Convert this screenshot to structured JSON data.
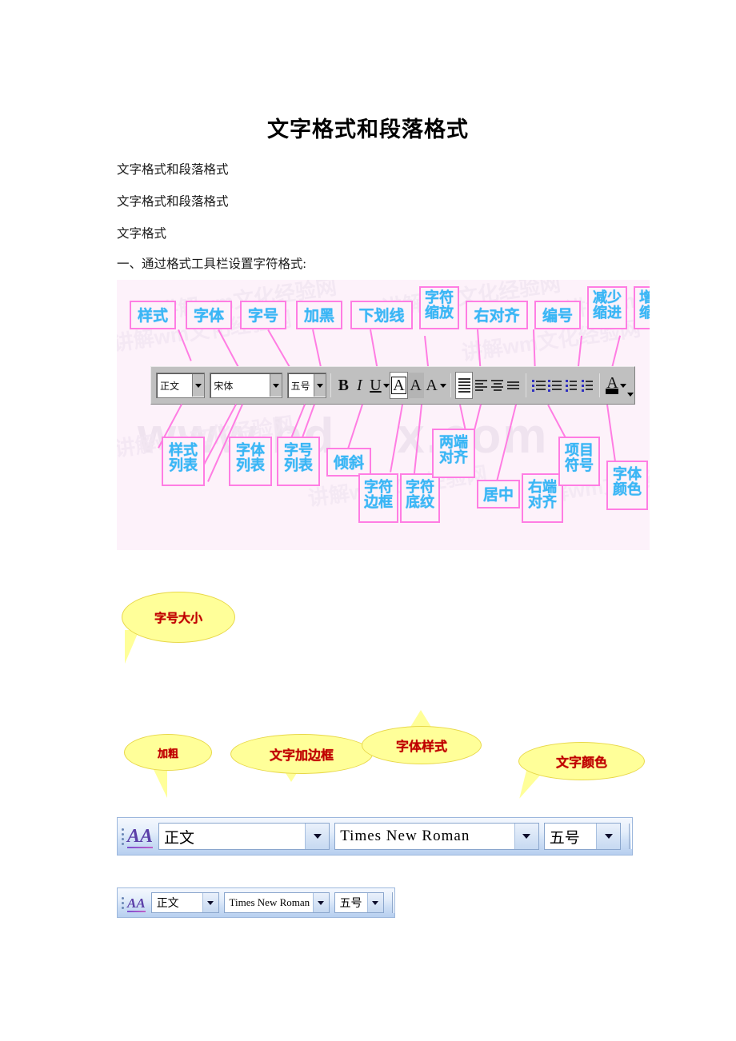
{
  "document": {
    "title": "文字格式和段落格式",
    "paragraphs": [
      "文字格式和段落格式",
      "文字格式和段落格式",
      "文字格式",
      "一、通过格式工具栏设置字符格式:"
    ]
  },
  "diagram": {
    "watermark_main": "www.bd",
    "watermark_main_tail": "x.com",
    "watermark_dot": ".",
    "watermark_small": "讲解wm文化经验网",
    "top_labels": [
      {
        "text": "样式"
      },
      {
        "text": "字体"
      },
      {
        "text": "字号"
      },
      {
        "text": "加黑"
      },
      {
        "text": "下划线"
      },
      {
        "line1": "字符",
        "line2": "缩放"
      },
      {
        "text": "右对齐"
      },
      {
        "text": "编号"
      },
      {
        "line1": "减少",
        "line2": "缩进"
      },
      {
        "line1": "增加",
        "line2": "缩进"
      }
    ],
    "bottom_labels": [
      {
        "line1": "样式",
        "line2": "列表"
      },
      {
        "line1": "字体",
        "line2": "列表"
      },
      {
        "line1": "字号",
        "line2": "列表"
      },
      {
        "text": "倾斜"
      },
      {
        "line1": "字符",
        "line2": "边框"
      },
      {
        "line1": "字符",
        "line2": "底纹"
      },
      {
        "line1": "两端",
        "line2": "对齐"
      },
      {
        "text": "居中"
      },
      {
        "line1": "右端",
        "line2": "对齐"
      },
      {
        "line1": "项目",
        "line2": "符号"
      },
      {
        "line1": "字体",
        "line2": "颜色"
      }
    ],
    "toolbar97": {
      "style_value": "正文",
      "font_value": "宋体",
      "size_value": "五号",
      "bold_label": "B",
      "italic_label": "I",
      "underline_label": "U",
      "border_label": "A",
      "shading_label": "A",
      "scale_label": "A",
      "color_label": "A"
    }
  },
  "bubbles": [
    {
      "text": "字号大小"
    },
    {
      "text": "加粗"
    },
    {
      "text": "文字加边框"
    },
    {
      "text": "字体样式"
    },
    {
      "text": "文字颜色"
    }
  ],
  "word_toolbar_large": {
    "style_value": "正文",
    "font_value": "Times New Roman",
    "size_value": "五号",
    "styles_icon_label": "AA"
  },
  "word_toolbar_small": {
    "style_value": "正文",
    "font_value": "Times New Roman",
    "size_value": "五号",
    "styles_icon_label": "AA"
  },
  "colors": {
    "label_border": "#ff7de3",
    "label_text": "#3ab6f5",
    "bubble_fill": "#ffff99",
    "bubble_text": "#c00000",
    "diagram_bg": "#fdf2fa"
  }
}
